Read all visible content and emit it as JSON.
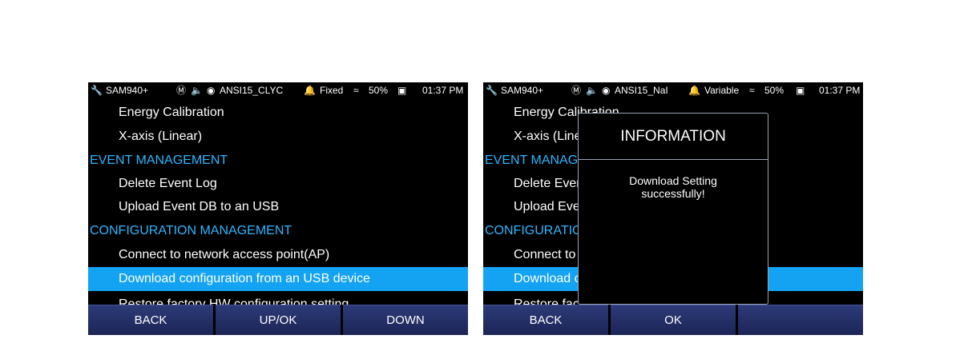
{
  "left": {
    "status": {
      "device": "SAM940+",
      "library": "ANSI15_CLYC",
      "mode": "Fixed",
      "battery": "50%",
      "time": "01:37 PM"
    },
    "menu": [
      {
        "label": "Energy Calibration",
        "kind": "item"
      },
      {
        "label": "X-axis (Linear)",
        "kind": "item"
      },
      {
        "label": "EVENT MANAGEMENT",
        "kind": "header"
      },
      {
        "label": "Delete Event Log",
        "kind": "item"
      },
      {
        "label": "Upload Event DB to an USB",
        "kind": "item"
      },
      {
        "label": "CONFIGURATION MANAGEMENT",
        "kind": "header"
      },
      {
        "label": "Connect to network access point(AP)",
        "kind": "item"
      },
      {
        "label": "Download configuration from an USB device",
        "kind": "item",
        "selected": true
      },
      {
        "label": "Restore factory HW configuration setting",
        "kind": "item"
      }
    ],
    "softkeys": [
      "BACK",
      "UP/OK",
      "DOWN"
    ]
  },
  "right": {
    "status": {
      "device": "SAM940+",
      "library": "ANSI15_NaI",
      "mode": "Variable",
      "battery": "50%",
      "time": "01:37 PM"
    },
    "menu": [
      {
        "label": "Energy Calibration",
        "kind": "item"
      },
      {
        "label": "X-axis (Linear)",
        "kind": "item"
      },
      {
        "label": "EVENT MANAGEMENT",
        "kind": "header"
      },
      {
        "label": "Delete Event Log",
        "kind": "item"
      },
      {
        "label": "Upload Event DB to an USB",
        "kind": "item"
      },
      {
        "label": "CONFIGURATION MANAGEMENT",
        "kind": "header"
      },
      {
        "label": "Connect to network access point(AP)",
        "kind": "item"
      },
      {
        "label": "Download configuration from an USB device",
        "kind": "item",
        "selected": true
      },
      {
        "label": "Restore factory HW configuration setting",
        "kind": "item"
      }
    ],
    "dialog": {
      "title": "INFORMATION",
      "message_line1": "Download Setting",
      "message_line2": "successfully!"
    },
    "softkeys": [
      "BACK",
      "OK",
      ""
    ]
  },
  "icons": [
    "wrench-icon",
    "s-badge-icon",
    "speaker-icon",
    "library-icon",
    "bell-icon",
    "wifi-icon",
    "battery-icon"
  ],
  "colors": {
    "header_text": "#2fb6ff",
    "selected_row": "#13a3f2",
    "softkey_bg": "#1c2555",
    "screen_bg": "#000000"
  }
}
